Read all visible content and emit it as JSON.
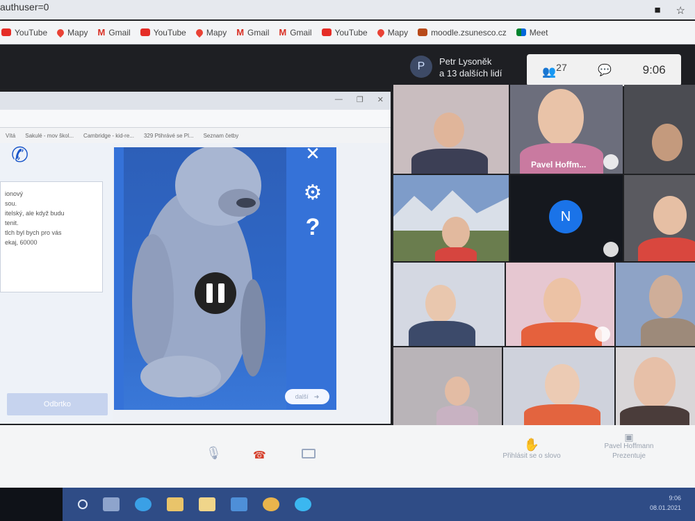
{
  "browser": {
    "url_fragment": "authuser=0",
    "bookmarks": [
      {
        "label": "YouTube",
        "icon": "youtube-icon"
      },
      {
        "label": "Mapy",
        "icon": "maps-pin-icon"
      },
      {
        "label": "Gmail",
        "icon": "gmail-icon"
      },
      {
        "label": "YouTube",
        "icon": "youtube-icon"
      },
      {
        "label": "Mapy",
        "icon": "maps-pin-icon"
      },
      {
        "label": "Gmail",
        "icon": "gmail-icon"
      },
      {
        "label": "Gmail",
        "icon": "gmail-icon"
      },
      {
        "label": "YouTube",
        "icon": "youtube-icon"
      },
      {
        "label": "Mapy",
        "icon": "maps-pin-icon"
      },
      {
        "label": "moodle.zsunesco.cz",
        "icon": "moodle-icon"
      },
      {
        "label": "Meet",
        "icon": "meet-icon"
      }
    ]
  },
  "meet": {
    "presenter_initial": "P",
    "presenter_name": "Petr Lysoněk",
    "presenter_others": "a 13 dalších lidí",
    "people_count": "27",
    "time": "9:06",
    "shared_screen": {
      "inner_bookmarks": [
        "Vítá",
        "Sakulé - mov škol...",
        "Cambridge - kid-re...",
        "329 Ptihrávé se Pl...",
        "Seznam četby"
      ],
      "text_panel_lines": [
        "ionový",
        "sou.",
        "itelský, ale když budu",
        "tenit.",
        "tlch byl bych pro vás",
        "ekaj, 60000"
      ],
      "app_button_label": "Odbrtko",
      "next_label": "další"
    },
    "participants": [
      {
        "name": ""
      },
      {
        "name": "Pavel Hoffm..."
      },
      {
        "name": ""
      },
      {
        "name": ""
      },
      {
        "name": "",
        "initial": "N"
      },
      {
        "name": ""
      },
      {
        "name": ""
      },
      {
        "name": ""
      },
      {
        "name": ""
      },
      {
        "name": ""
      },
      {
        "name": ""
      },
      {
        "name": ""
      }
    ],
    "bottom": {
      "raise_hand_label": "Přihlásit se o slovo",
      "presenting_name": "Pavel Hoffmann",
      "presenting_label": "Prezentuje"
    }
  },
  "taskbar": {
    "time": "9:06",
    "date": "08.01.2021"
  }
}
